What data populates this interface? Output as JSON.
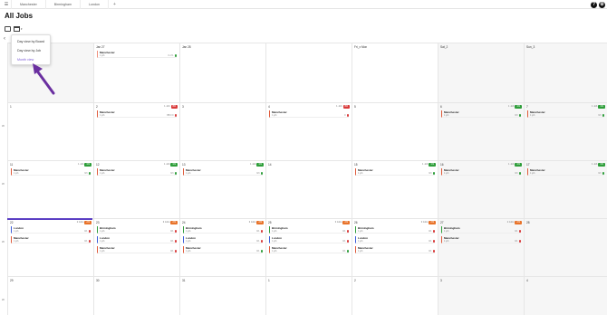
{
  "topbar": {
    "tabs": [
      "Manchester",
      "Birmingham",
      "London"
    ],
    "plus": "+",
    "help": "?",
    "settings": "⚙"
  },
  "header": {
    "title": "All Jobs"
  },
  "view_menu": {
    "items": [
      "Day view by Board",
      "Day view by Job",
      "Month view"
    ],
    "selected": "Month view"
  },
  "calendar": {
    "weekday_headers": [
      "",
      "",
      "",
      "",
      "Fri_x Mon",
      "Sat_2",
      "Sun_3"
    ],
    "week_numbers": [
      "",
      "W",
      "W",
      "W",
      "W"
    ],
    "weeks": [
      {
        "days": [
          {
            "n": "",
            "grey": true,
            "jobs": []
          },
          {
            "n": "Jan 27",
            "grey": false,
            "jobs": [
              {
                "title": "Manchester",
                "sub": "1 job",
                "right": "0 of 1",
                "color": "#ef8f7a",
                "dot": "#2e9e3a"
              }
            ]
          },
          {
            "n": "Jan 28",
            "grey": false,
            "jobs": []
          },
          {
            "n": "",
            "grey": false,
            "jobs": []
          },
          {
            "n": "",
            "grey": false,
            "jobs": []
          },
          {
            "n": "",
            "grey": true,
            "jobs": []
          },
          {
            "n": "",
            "grey": true,
            "jobs": []
          }
        ]
      },
      {
        "days": [
          {
            "n": "1",
            "grey": false,
            "jobs": []
          },
          {
            "n": "2",
            "grey": false,
            "count": "1 Job",
            "badge": "BB",
            "badge_color": "#d93a3a",
            "jobs": [
              {
                "title": "Manchester",
                "sub": "1 job",
                "right": "BB 0 0",
                "color": "#e05a3a",
                "dot": "#d93a3a"
              }
            ]
          },
          {
            "n": "3",
            "grey": false,
            "jobs": []
          },
          {
            "n": "4",
            "grey": false,
            "count": "1 Job",
            "badge": "BB",
            "badge_color": "#d93a3a",
            "jobs": [
              {
                "title": "Manchester",
                "sub": "1 job",
                "right": "0",
                "color": "#e05a3a",
                "dot": "#d93a3a"
              }
            ]
          },
          {
            "n": "5",
            "grey": false,
            "jobs": []
          },
          {
            "n": "6",
            "grey": true,
            "count": "1 Job",
            "badge": "3/3",
            "badge_color": "#2e9e3a",
            "jobs": [
              {
                "title": "Manchester",
                "sub": "1 job",
                "right": "3/3",
                "color": "#e05a3a",
                "dot": "#2e9e3a"
              }
            ]
          },
          {
            "n": "7",
            "grey": true,
            "count": "1 Job",
            "badge": "3/3",
            "badge_color": "#2e9e3a",
            "jobs": [
              {
                "title": "Manchester",
                "sub": "1 job",
                "right": "3/3",
                "color": "#e05a3a",
                "dot": "#2e9e3a"
              }
            ]
          }
        ]
      },
      {
        "days": [
          {
            "n": "11",
            "grey": false,
            "count": "1 Job",
            "badge": "3/3",
            "badge_color": "#2e9e3a",
            "jobs": [
              {
                "title": "Manchester",
                "sub": "1 job",
                "right": "3/3",
                "color": "#e05a3a",
                "dot": "#2e9e3a"
              }
            ]
          },
          {
            "n": "12",
            "grey": false,
            "count": "1 Job",
            "badge": "3/3",
            "badge_color": "#2e9e3a",
            "jobs": [
              {
                "title": "Manchester",
                "sub": "1 job",
                "right": "3/3",
                "color": "#e05a3a",
                "dot": "#2e9e3a"
              }
            ]
          },
          {
            "n": "13",
            "grey": false,
            "count": "1 Job",
            "badge": "3/3",
            "badge_color": "#2e9e3a",
            "jobs": [
              {
                "title": "Manchester",
                "sub": "1 job",
                "right": "3/3",
                "color": "#e05a3a",
                "dot": "#2e9e3a"
              }
            ]
          },
          {
            "n": "14",
            "grey": false,
            "jobs": []
          },
          {
            "n": "15",
            "grey": false,
            "count": "1 Job",
            "badge": "3/3",
            "badge_color": "#2e9e3a",
            "jobs": [
              {
                "title": "Manchester",
                "sub": "1 job",
                "right": "3/3",
                "color": "#e05a3a",
                "dot": "#2e9e3a"
              }
            ]
          },
          {
            "n": "16",
            "grey": true,
            "count": "1 Job",
            "badge": "3/3",
            "badge_color": "#2e9e3a",
            "jobs": [
              {
                "title": "Manchester",
                "sub": "1 job",
                "right": "3/3",
                "color": "#e05a3a",
                "dot": "#2e9e3a"
              }
            ]
          },
          {
            "n": "17",
            "grey": true,
            "count": "1 Job",
            "badge": "3/3",
            "badge_color": "#2e9e3a",
            "jobs": [
              {
                "title": "Manchester",
                "sub": "1 job",
                "right": "3/3",
                "color": "#e05a3a",
                "dot": "#2e9e3a"
              }
            ]
          }
        ]
      },
      {
        "days": [
          {
            "n": "22",
            "grey": false,
            "count": "2 Jobs",
            "badge": "2/3",
            "badge_color": "#e8732a",
            "jobs": [
              {
                "title": "London",
                "sub": "1 job",
                "right": "0/1",
                "color": "#3a5bd9",
                "dot": "#d93a3a"
              },
              {
                "title": "Manchester",
                "sub": "1 job",
                "right": "0/1",
                "color": "#e05a3a",
                "dot": "#d93a3a"
              }
            ]
          },
          {
            "n": "23",
            "grey": false,
            "count": "3 Jobs",
            "badge": "2/3",
            "badge_color": "#e8732a",
            "jobs": [
              {
                "title": "Birmingham",
                "sub": "1 job",
                "right": "0/1",
                "color": "#2e9e3a",
                "dot": "#d93a3a"
              },
              {
                "title": "London",
                "sub": "1 job",
                "right": "0/1",
                "color": "#3a5bd9",
                "dot": "#d93a3a"
              },
              {
                "title": "Manchester",
                "sub": "1 job",
                "right": "0/1",
                "color": "#e05a3a",
                "dot": "#d93a3a"
              }
            ]
          },
          {
            "n": "24",
            "grey": false,
            "count": "3 Jobs",
            "badge": "2/3",
            "badge_color": "#e8732a",
            "jobs": [
              {
                "title": "Birmingham",
                "sub": "1 job",
                "right": "0/1",
                "color": "#2e9e3a",
                "dot": "#d93a3a"
              },
              {
                "title": "London",
                "sub": "1 job",
                "right": "0/1",
                "color": "#3a5bd9",
                "dot": "#d93a3a"
              },
              {
                "title": "Manchester",
                "sub": "1 job",
                "right": "0/1",
                "color": "#e05a3a",
                "dot": "#2e9e3a"
              }
            ]
          },
          {
            "n": "25",
            "grey": false,
            "count": "3 Jobs",
            "badge": "2/3",
            "badge_color": "#e8732a",
            "jobs": [
              {
                "title": "Birmingham",
                "sub": "1 job",
                "right": "0/1",
                "color": "#2e9e3a",
                "dot": "#d93a3a"
              },
              {
                "title": "London",
                "sub": "1 job",
                "right": "0/1",
                "color": "#3a5bd9",
                "dot": "#d93a3a"
              },
              {
                "title": "Manchester",
                "sub": "1 job",
                "right": "0/1",
                "color": "#e05a3a",
                "dot": "#2e9e3a"
              }
            ]
          },
          {
            "n": "26",
            "grey": false,
            "count": "3 Jobs",
            "badge": "2/3",
            "badge_color": "#e8732a",
            "jobs": [
              {
                "title": "Birmingham",
                "sub": "1 job",
                "right": "0/1",
                "color": "#2e9e3a",
                "dot": "#d93a3a"
              },
              {
                "title": "London",
                "sub": "1 job",
                "right": "0/1",
                "color": "#3a5bd9",
                "dot": "#d93a3a"
              },
              {
                "title": "Manchester",
                "sub": "1 job",
                "right": "0/1",
                "color": "#e05a3a",
                "dot": "#d93a3a"
              }
            ]
          },
          {
            "n": "27",
            "grey": true,
            "count": "2 Jobs",
            "badge": "2/3",
            "badge_color": "#e8732a",
            "jobs": [
              {
                "title": "Birmingham",
                "sub": "1 job",
                "right": "0/1",
                "color": "#2e9e3a",
                "dot": "#d93a3a"
              },
              {
                "title": "Manchester",
                "sub": "1 job",
                "right": "0/1",
                "color": "#e05a3a",
                "dot": "#d93a3a"
              }
            ]
          },
          {
            "n": "28",
            "grey": true,
            "jobs": []
          }
        ]
      },
      {
        "days": [
          {
            "n": "29",
            "grey": false,
            "jobs": []
          },
          {
            "n": "30",
            "grey": false,
            "jobs": []
          },
          {
            "n": "31",
            "grey": false,
            "jobs": []
          },
          {
            "n": "1",
            "grey": false,
            "jobs": []
          },
          {
            "n": "2",
            "grey": false,
            "jobs": []
          },
          {
            "n": "3",
            "grey": true,
            "jobs": []
          },
          {
            "n": "4",
            "grey": true,
            "jobs": []
          }
        ]
      }
    ]
  }
}
